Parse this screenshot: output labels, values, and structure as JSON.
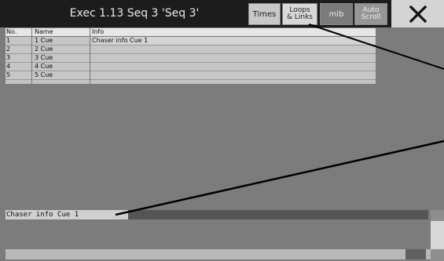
{
  "header": {
    "title": "Exec 1.13 Seq 3 'Seq 3'",
    "buttons": {
      "times": "Times",
      "loops_links": "Loops\n& Links",
      "mib": "mib",
      "auto_scroll": "Auto\nScroll"
    }
  },
  "table": {
    "columns": [
      "No.",
      "Name",
      "Info"
    ],
    "rows": [
      {
        "no": "1",
        "name": "1 Cue",
        "info": "Chaser info Cue 1"
      },
      {
        "no": "2",
        "name": "2 Cue",
        "info": ""
      },
      {
        "no": "3",
        "name": "3 Cue",
        "info": ""
      },
      {
        "no": "4",
        "name": "4 Cue",
        "info": ""
      },
      {
        "no": "5",
        "name": "5 Cue",
        "info": ""
      }
    ]
  },
  "editor": {
    "text": "Chaser info Cue 1"
  }
}
